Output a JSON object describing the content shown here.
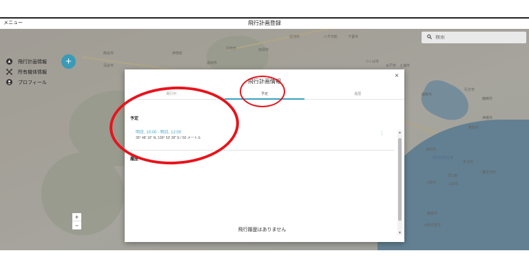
{
  "topbar": {
    "menu_label": "メニュー",
    "title": "飛行計画登録"
  },
  "search": {
    "placeholder": "検索",
    "icon": "search-icon"
  },
  "sidebar": {
    "items": [
      {
        "label": "飛行計画情報",
        "icon": "navigation-icon"
      },
      {
        "label": "所有機体情報",
        "icon": "drone-icon"
      },
      {
        "label": "プロフィール",
        "icon": "account-icon"
      }
    ]
  },
  "fab": {
    "label": "+"
  },
  "zoom": {
    "in": "+",
    "out": "−"
  },
  "map_labels": [
    "水戸市",
    "つくば市",
    "土浦市",
    "行方市",
    "鹿嶋市",
    "成田市",
    "香取市",
    "八街市",
    "東金市",
    "大網白里市",
    "古河市",
    "八千代町",
    "下妻市",
    "加須市",
    "行田市",
    "伊奈町",
    "蓮田市",
    "熊谷市",
    "深谷市",
    "稲敷市",
    "神栖市",
    "芝山町",
    "横芝光町",
    "多古町",
    "山武市",
    "成田国際空港"
  ],
  "dialog": {
    "title": "飛行計画情報",
    "close": "×",
    "tabs": [
      {
        "label": "飛行中",
        "active": false
      },
      {
        "label": "予定",
        "active": true
      },
      {
        "label": "履歴",
        "active": false
      }
    ],
    "section_scheduled": "予定",
    "entry": {
      "time": "明日, 10:00 - 明日, 12:00",
      "location": "35° 48' 16\" N, 139° 53' 28\" E / 50 メートル",
      "menu": "⋮"
    },
    "section_history": "履歴",
    "empty_history": "飛行履歴はありません"
  },
  "colors": {
    "accent": "#3aa0bd",
    "annotation": "#e8131b",
    "sea": "#5a8fb0"
  }
}
